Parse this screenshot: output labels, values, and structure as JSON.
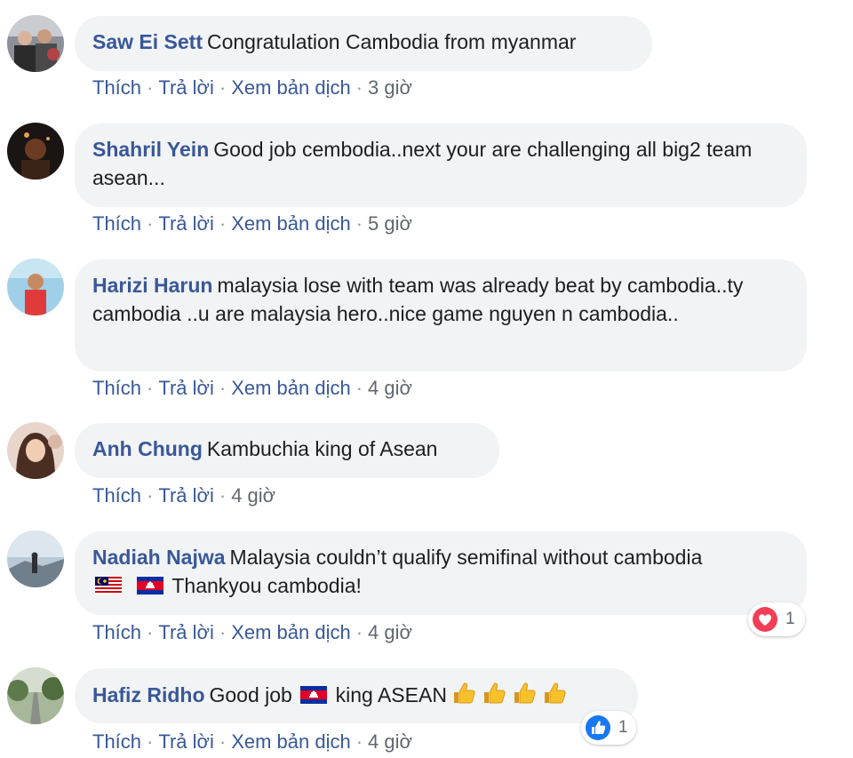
{
  "actions": {
    "like_label": "Thích",
    "reply_label": "Trả lời",
    "translate_label": "Xem bản dịch",
    "separator": "·"
  },
  "colors": {
    "author": "#385898",
    "bubble_bg": "#f2f3f5",
    "heart": "#f33e58",
    "like_blue": "#1877f2"
  },
  "comments": [
    {
      "author": "Saw Ei Sett",
      "text": "Congratulation Cambodia from myanmar",
      "time": "3 giờ",
      "has_translate": true
    },
    {
      "author": "Shahril Yein",
      "text": "Good job cembodia..next your are challenging all big2 team asean...",
      "time": "5 giờ",
      "has_translate": true
    },
    {
      "author": "Harizi Harun",
      "text": "malaysia lose with team was already beat by cambodia..ty cambodia ..u are malaysia hero..nice game nguyen n cambodia..",
      "time": "4 giờ",
      "has_translate": true
    },
    {
      "author": "Anh Chung",
      "text": "Kambuchia king of Asean",
      "time": "4 giờ",
      "has_translate": false
    },
    {
      "author": "Nadiah Najwa",
      "text_line1": "Malaysia couldn’t qualify semifinal without cambodia",
      "flags": [
        "malaysia-flag",
        "cambodia-flag"
      ],
      "text_line2": "Thankyou cambodia!",
      "time": "4 giờ",
      "has_translate": true,
      "reaction": {
        "icon": "heart-icon",
        "count": "1"
      }
    },
    {
      "author": "Hafiz Ridho",
      "text_before_flag": "Good job",
      "flag": "cambodia-flag",
      "text_after_flag": "king ASEAN",
      "emojis": [
        "thumbs-up-icon",
        "thumbs-up-icon",
        "thumbs-up-icon",
        "thumbs-up-icon"
      ],
      "time": "4 giờ",
      "has_translate": true,
      "reaction": {
        "icon": "like-icon",
        "count": "1"
      }
    }
  ]
}
